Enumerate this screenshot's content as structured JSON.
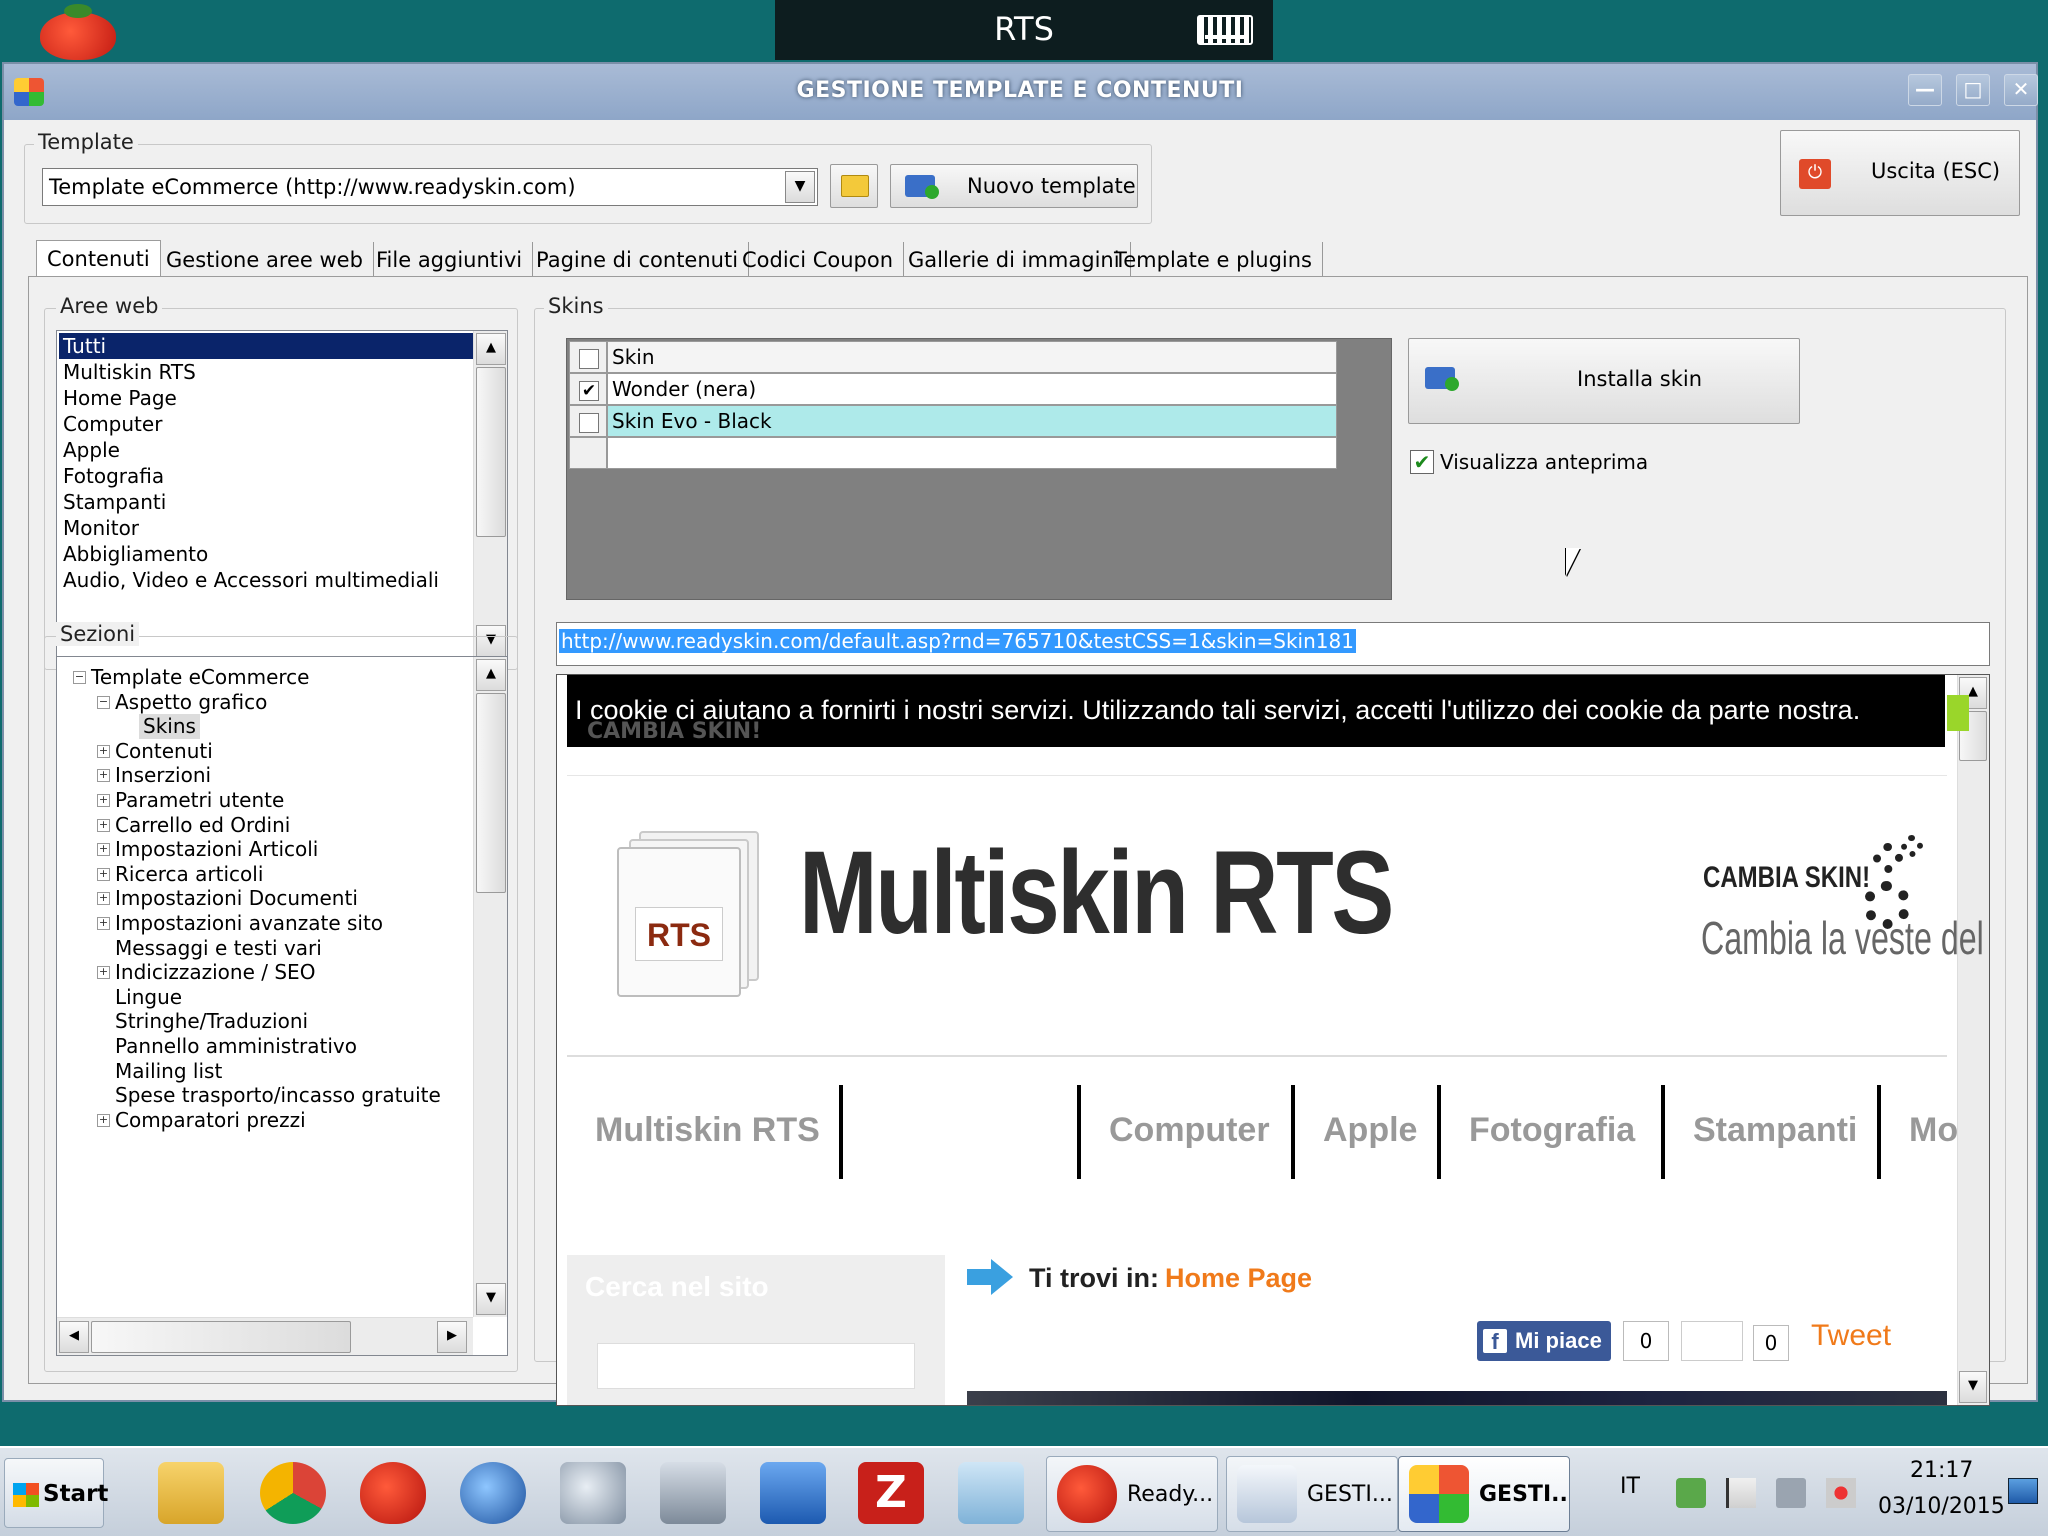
{
  "remote": {
    "title": "RTS"
  },
  "window": {
    "title": "GESTIONE TEMPLATE E CONTENUTI",
    "controls": {
      "minimize": "—",
      "maximize": "□",
      "close": "✕"
    }
  },
  "template": {
    "legend": "Template",
    "selected": "Template eCommerce (http://www.readyskin.com)",
    "new_button": "Nuovo template",
    "exit_button": "Uscita (ESC)"
  },
  "tabs": [
    {
      "label": "Contenuti",
      "active": true
    },
    {
      "label": "Gestione aree web"
    },
    {
      "label": "File aggiuntivi"
    },
    {
      "label": "Pagine di contenuti"
    },
    {
      "label": "Codici Coupon"
    },
    {
      "label": "Gallerie di immagini"
    },
    {
      "label": "Template e plugins"
    }
  ],
  "aree_web": {
    "legend": "Aree web",
    "items": [
      "Tutti",
      "Multiskin RTS",
      "Home Page",
      "Computer",
      "Apple",
      "Fotografia",
      "Stampanti",
      "Monitor",
      "Abbigliamento",
      "Audio, Video e Accessori multimediali"
    ],
    "selected_index": 0
  },
  "sezioni": {
    "legend": "Sezioni",
    "items": [
      {
        "label": "Template eCommerce",
        "level": 0,
        "toggle": "−"
      },
      {
        "label": "Aspetto grafico",
        "level": 1,
        "toggle": "−"
      },
      {
        "label": "Skins",
        "level": 2,
        "toggle": ""
      },
      {
        "label": "Contenuti",
        "level": 1,
        "toggle": "+"
      },
      {
        "label": "Inserzioni",
        "level": 1,
        "toggle": "+"
      },
      {
        "label": "Parametri utente",
        "level": 1,
        "toggle": "+"
      },
      {
        "label": "Carrello ed Ordini",
        "level": 1,
        "toggle": "+"
      },
      {
        "label": "Impostazioni Articoli",
        "level": 1,
        "toggle": "+"
      },
      {
        "label": "Ricerca articoli",
        "level": 1,
        "toggle": "+"
      },
      {
        "label": "Impostazioni Documenti",
        "level": 1,
        "toggle": "+"
      },
      {
        "label": "Impostazioni avanzate sito",
        "level": 1,
        "toggle": "+"
      },
      {
        "label": "Messaggi e testi vari",
        "level": 1,
        "toggle": ""
      },
      {
        "label": "Indicizzazione / SEO",
        "level": 1,
        "toggle": "+"
      },
      {
        "label": "Lingue",
        "level": 1,
        "toggle": ""
      },
      {
        "label": "Stringhe/Traduzioni",
        "level": 1,
        "toggle": ""
      },
      {
        "label": "Pannello amministrativo",
        "level": 1,
        "toggle": ""
      },
      {
        "label": "Mailing list",
        "level": 1,
        "toggle": ""
      },
      {
        "label": "Spese trasporto/incasso gratuite",
        "level": 1,
        "toggle": ""
      },
      {
        "label": "Comparatori prezzi",
        "level": 1,
        "toggle": "+"
      }
    ]
  },
  "skins": {
    "legend": "Skins",
    "header": "Skin",
    "rows": [
      {
        "label": "Wonder (nera)",
        "checked": true
      },
      {
        "label": "Skin Evo - Black",
        "checked": false
      }
    ],
    "install_button": "Installa skin",
    "preview_checkbox": "Visualizza anteprima"
  },
  "preview": {
    "url": "http://www.readyskin.com/default.asp?rnd=765710&testCSS=1&skin=Skin181",
    "cookie_text": "I cookie ci aiutano a fornirti i nostri servizi. Utilizzando tali servizi, accetti l'utilizzo dei cookie da parte nostra.",
    "cookie_behind": "CAMBIA SKIN!",
    "logo_box": "RTS",
    "brand": "Multiskin RTS",
    "tagline": "Cambia la veste del tuo e-commerce co",
    "cambia": "CAMBIA SKIN!",
    "nav": [
      "Multiskin RTS",
      "Computer",
      "Apple",
      "Fotografia",
      "Stampanti",
      "Mo"
    ],
    "search_title": "Cerca nel sito",
    "breadcrumb_label": "Ti trovi in:",
    "breadcrumb_link": "Home Page",
    "like_label": "Mi piace",
    "like_count": "0",
    "share_count": "0",
    "tweet": "Tweet"
  },
  "taskbar": {
    "start": "Start",
    "tasks": [
      "Ready...",
      "GESTI...",
      "GESTI..."
    ],
    "lang": "IT",
    "time": "21:17",
    "date": "03/10/2015"
  },
  "colors": {
    "desktop": "#0e6b6e",
    "selection": "#0a246a",
    "row_highlight": "#aeeaea",
    "link_orange": "#f07a1a",
    "facebook": "#3b5998"
  }
}
